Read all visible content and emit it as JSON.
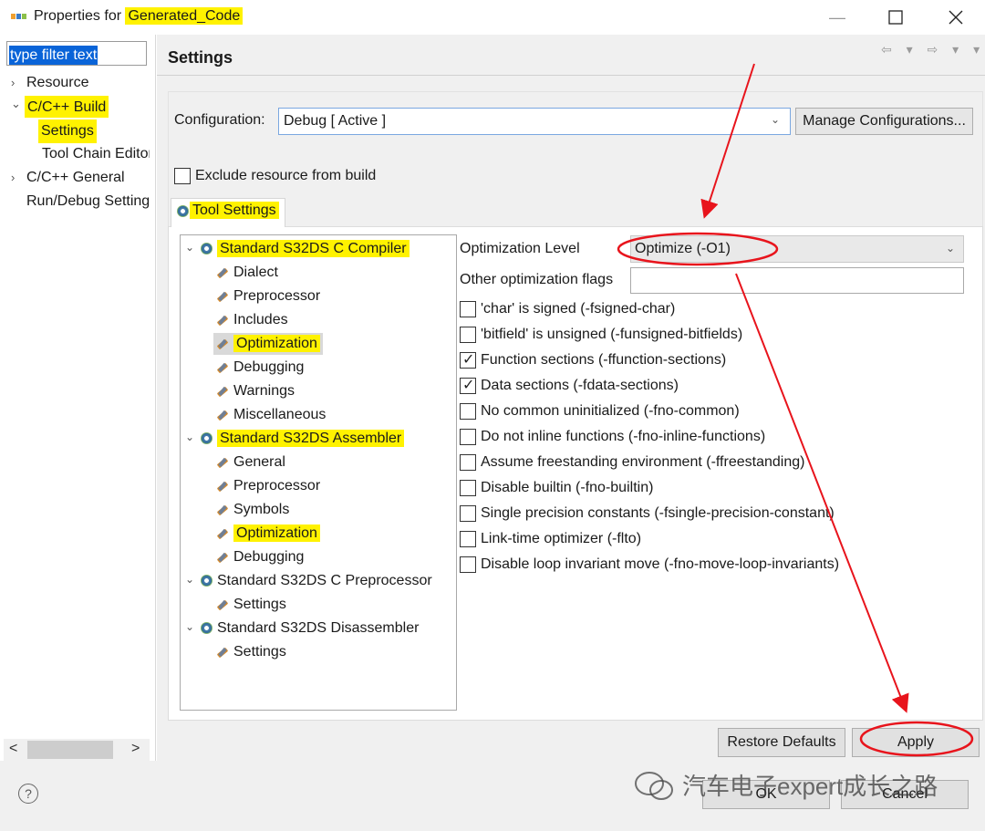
{
  "window": {
    "title_prefix": "Properties for ",
    "title_highlight": "Generated_Code",
    "minimize_glyph": "—",
    "maximize_icon": "maximize-icon",
    "close_icon": "close-icon"
  },
  "left_pane": {
    "filter_text": "type filter text",
    "items": [
      {
        "label": "Resource",
        "chevron": "›"
      },
      {
        "label": "C/C++ Build",
        "chevron": "⌄"
      },
      {
        "label": "Settings",
        "chevron": ""
      },
      {
        "label": "Tool Chain Editor",
        "chevron": ""
      },
      {
        "label": "C/C++ General",
        "chevron": "›"
      },
      {
        "label": "Run/Debug Settings",
        "chevron": ""
      }
    ],
    "scroll_left": "<",
    "scroll_right": ">"
  },
  "header": {
    "title": "Settings",
    "nav_arrows": "⇦ ▾ ⇨ ▾ ▾"
  },
  "configuration": {
    "label": "Configuration:",
    "value": "Debug  [ Active ]",
    "manage_button": "Manage Configurations..."
  },
  "exclude": {
    "label": "Exclude resource from build",
    "checked": false
  },
  "tab": {
    "label": "Tool Settings"
  },
  "tool_tree": {
    "compiler": {
      "label": "Standard S32DS C Compiler",
      "children": [
        "Dialect",
        "Preprocessor",
        "Includes",
        "Optimization",
        "Debugging",
        "Warnings",
        "Miscellaneous"
      ]
    },
    "assembler": {
      "label": "Standard S32DS Assembler",
      "children": [
        "General",
        "Preprocessor",
        "Symbols",
        "Optimization",
        "Debugging"
      ]
    },
    "preprocessor": {
      "label": "Standard S32DS C Preprocessor",
      "children": [
        "Settings"
      ]
    },
    "disassembler": {
      "label": "Standard S32DS Disassembler",
      "children": [
        "Settings"
      ]
    }
  },
  "optimization": {
    "level_label": "Optimization Level",
    "level_value": "Optimize (-O1)",
    "other_flags_label": "Other optimization flags",
    "other_flags_value": "",
    "options": [
      {
        "label": "'char' is signed (-fsigned-char)",
        "checked": false
      },
      {
        "label": "'bitfield' is unsigned (-funsigned-bitfields)",
        "checked": false
      },
      {
        "label": "Function sections (-ffunction-sections)",
        "checked": true
      },
      {
        "label": "Data sections (-fdata-sections)",
        "checked": true
      },
      {
        "label": "No common uninitialized (-fno-common)",
        "checked": false
      },
      {
        "label": "Do not inline functions (-fno-inline-functions)",
        "checked": false
      },
      {
        "label": "Assume freestanding environment (-ffreestanding)",
        "checked": false
      },
      {
        "label": "Disable builtin (-fno-builtin)",
        "checked": false
      },
      {
        "label": "Single precision constants (-fsingle-precision-constant)",
        "checked": false
      },
      {
        "label": "Link-time optimizer (-flto)",
        "checked": false
      },
      {
        "label": "Disable loop invariant move (-fno-move-loop-invariants)",
        "checked": false
      }
    ]
  },
  "buttons": {
    "restore": "Restore Defaults",
    "apply": "Apply",
    "ok": "OK",
    "cancel": "Cancel",
    "help": "?"
  },
  "watermark": "汽车电子expert成长之路",
  "colors": {
    "highlight": "#fff200",
    "annotation": "#e8141c",
    "selection": "#0a64d8"
  }
}
